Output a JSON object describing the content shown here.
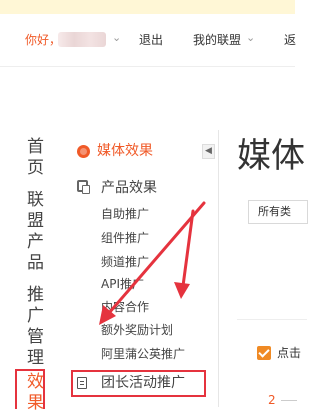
{
  "top_nav": {
    "greeting": "你好，",
    "logout": "退出",
    "my_league": "我的联盟",
    "back": "返"
  },
  "left_nav": {
    "categories": [
      {
        "label": "首页"
      },
      {
        "label": "联盟产品"
      },
      {
        "label": "推广管理"
      },
      {
        "label": "效果"
      }
    ]
  },
  "sub_nav": {
    "sections": [
      {
        "label": "媒体效果",
        "icon": "globe-icon",
        "active": true
      },
      {
        "label": "产品效果",
        "icon": "product-icon"
      }
    ],
    "items": [
      "自助推广",
      "组件推广",
      "频道推广",
      "API推广",
      "内容合作",
      "额外奖励计划",
      "阿里蒲公英推广"
    ],
    "highlighted_item": {
      "label": "团长活动推广",
      "icon": "document-icon"
    },
    "collapse_icon": "chevron-left-icon"
  },
  "main": {
    "title": "媒体",
    "filter_value": "所有类",
    "checkbox_label": "点击",
    "pager_text": "2"
  },
  "colors": {
    "accent": "#f05a28",
    "annotation_red": "#e5333e",
    "checkbox": "#f08a24"
  }
}
